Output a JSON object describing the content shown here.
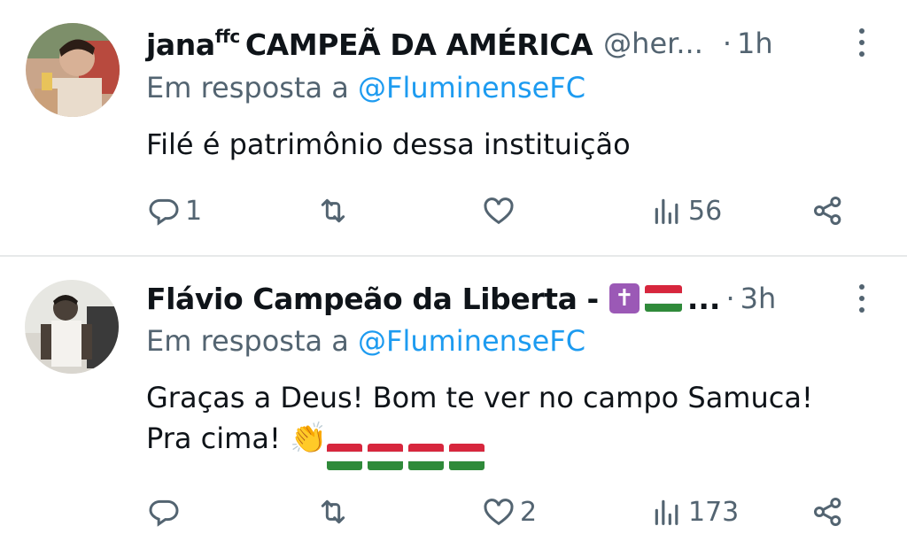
{
  "tweets": [
    {
      "name": "jana",
      "name_sup": "ffc",
      "name_rest": "CAMPEÃ DA AMÉRICA",
      "handle": "@her...",
      "time": "1h",
      "reply_prefix": "Em resposta a",
      "reply_mention": "@FluminenseFC",
      "text_line1": "Filé é patrimônio dessa instituição",
      "replies": "1",
      "retweets": "",
      "likes": "",
      "views": "56"
    },
    {
      "name": "Flávio Campeão da Liberta -",
      "name_suffix": "...",
      "time": "3h",
      "reply_prefix": "Em resposta a",
      "reply_mention": "@FluminenseFC",
      "text_line1": "Graças a Deus! Bom te ver no campo Samuca!",
      "text_line2": "Pra cima!",
      "replies": "",
      "retweets": "",
      "likes": "2",
      "views": "173"
    }
  ],
  "separator_dot": "·",
  "cross_glyph": "✝",
  "clap_emoji": "👏",
  "colors": {
    "text": "#0f1419",
    "muted": "#536471",
    "link": "#1d9bf0",
    "divider": "#e7e9ea",
    "flag_red": "#d7263d",
    "flag_green": "#2f8a3a",
    "cross_purple": "#9b59b6"
  },
  "icons": [
    "reply-icon",
    "retweet-icon",
    "like-icon",
    "views-icon",
    "share-icon",
    "more-icon"
  ]
}
